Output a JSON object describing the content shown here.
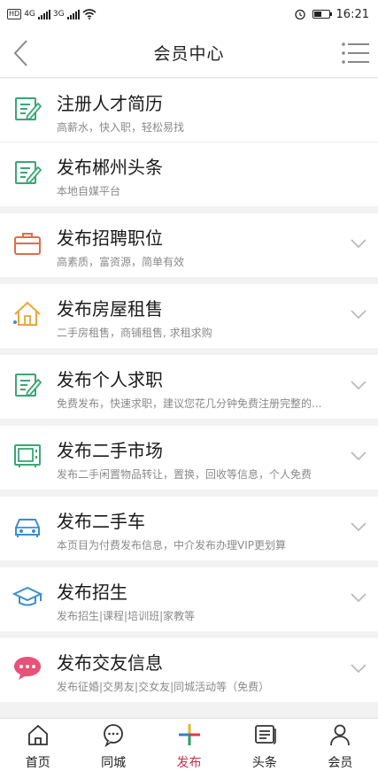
{
  "status_bar": {
    "sim1": "4G",
    "sim2": "3G",
    "time": "16:21"
  },
  "header": {
    "title": "会员中心",
    "back_icon": "chevron-left-icon",
    "menu_icon": "list-menu-icon"
  },
  "items": [
    {
      "title": "注册人才简历",
      "subtitle": "高薪水，快入职，轻松易找",
      "icon": "edit-doc-icon",
      "color": "#3aa675",
      "has_chevron": false
    },
    {
      "title": "发布郴州头条",
      "subtitle": "本地自媒平台",
      "icon": "edit-doc-icon",
      "color": "#3aa675",
      "has_chevron": false
    },
    {
      "title": "发布招聘职位",
      "subtitle": "高素质，富资源，简单有效",
      "icon": "briefcase-icon",
      "color": "#d9704b",
      "has_chevron": true
    },
    {
      "title": "发布房屋租售",
      "subtitle": "二手房租售，商铺租售, 求租求购",
      "icon": "house-icon",
      "color": "#e9a63a",
      "has_chevron": true
    },
    {
      "title": "发布个人求职",
      "subtitle": "免费发布，快速求职，建议您花几分钟免费注册完整的...",
      "icon": "edit-doc-icon",
      "color": "#3aa675",
      "has_chevron": true
    },
    {
      "title": "发布二手市场",
      "subtitle": "发布二手闲置物品转让，置换，回收等信息，个人免费",
      "icon": "microwave-icon",
      "color": "#3aa675",
      "has_chevron": true
    },
    {
      "title": "发布二手车",
      "subtitle": "本页目为付费发布信息，中介发布办理VIP更划算",
      "icon": "car-icon",
      "color": "#3b8fc9",
      "has_chevron": true
    },
    {
      "title": "发布招生",
      "subtitle": "发布招生|课程|培训班|家教等",
      "icon": "graduation-cap-icon",
      "color": "#3b8fc9",
      "has_chevron": true
    },
    {
      "title": "发布交友信息",
      "subtitle": "发布征婚|交男友|交女友|同城活动等（免费）",
      "icon": "chat-bubble-icon",
      "color": "#e8517a",
      "has_chevron": true
    }
  ],
  "tabbar": [
    {
      "label": "首页",
      "icon": "home-icon",
      "active": false
    },
    {
      "label": "同城",
      "icon": "chat-icon",
      "active": false
    },
    {
      "label": "发布",
      "icon": "plus-colorful-icon",
      "active": true
    },
    {
      "label": "头条",
      "icon": "news-icon",
      "active": false
    },
    {
      "label": "会员",
      "icon": "user-icon",
      "active": false
    }
  ],
  "colors": {
    "active_tab": "#c92f4e",
    "chevron": "#bbbbbb"
  }
}
